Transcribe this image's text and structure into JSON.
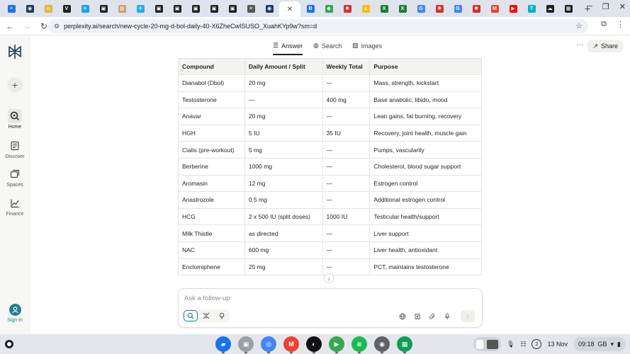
{
  "browser": {
    "tabs": [
      {
        "icon": "tab-favicon",
        "color": "#1a73e8",
        "glyph": "≡"
      },
      {
        "icon": "tab-favicon",
        "color": "#1e3a5f",
        "glyph": "◉"
      },
      {
        "icon": "tab-favicon",
        "color": "#e8b339",
        "glyph": "◎"
      },
      {
        "icon": "tab-favicon",
        "color": "#222222",
        "glyph": "V"
      },
      {
        "icon": "tab-favicon",
        "color": "#1da1f2",
        "glyph": "✈"
      },
      {
        "icon": "tab-favicon",
        "color": "#222222",
        "glyph": "▣"
      },
      {
        "icon": "tab-favicon",
        "color": "#c8a36b",
        "glyph": "▥"
      },
      {
        "icon": "tab-favicon",
        "color": "#2aabee",
        "glyph": "✈"
      },
      {
        "icon": "tab-favicon",
        "color": "#222222",
        "glyph": "▣"
      },
      {
        "icon": "tab-favicon",
        "color": "#222222",
        "glyph": "▣"
      },
      {
        "icon": "tab-favicon",
        "color": "#222222",
        "glyph": "▣"
      },
      {
        "icon": "tab-favicon",
        "color": "#222222",
        "glyph": "▣"
      },
      {
        "icon": "tab-favicon",
        "color": "#222222",
        "glyph": "▣"
      },
      {
        "icon": "tab-favicon",
        "color": "#555555",
        "glyph": "✕"
      },
      {
        "icon": "tab-favicon",
        "color": "#1e3a5f",
        "glyph": "◉"
      }
    ],
    "active_tab_close": "✕",
    "tabs_after": [
      {
        "icon": "tab-favicon",
        "color": "#1a73e8",
        "glyph": "B"
      },
      {
        "icon": "tab-favicon",
        "color": "#34a853",
        "glyph": "◆"
      },
      {
        "icon": "tab-favicon",
        "color": "#d93025",
        "glyph": "✱"
      },
      {
        "icon": "tab-favicon",
        "color": "#fbbc04",
        "glyph": "▲"
      },
      {
        "icon": "tab-favicon",
        "color": "#188038",
        "glyph": "X"
      },
      {
        "icon": "tab-favicon",
        "color": "#188038",
        "glyph": "X"
      },
      {
        "icon": "tab-favicon",
        "color": "#4285f4",
        "glyph": "G"
      },
      {
        "icon": "tab-favicon",
        "color": "#d93025",
        "glyph": "✱"
      },
      {
        "icon": "tab-favicon",
        "color": "#4285f4",
        "glyph": "G"
      },
      {
        "icon": "tab-favicon",
        "color": "#d93025",
        "glyph": "✱"
      },
      {
        "icon": "tab-favicon",
        "color": "#ea4335",
        "glyph": "M"
      },
      {
        "icon": "tab-favicon",
        "color": "#ff0000",
        "glyph": "▶"
      },
      {
        "icon": "tab-favicon",
        "color": "#00b3c7",
        "glyph": "T"
      },
      {
        "icon": "tab-favicon",
        "color": "#222222",
        "glyph": "☁"
      },
      {
        "icon": "tab-favicon",
        "color": "#222222",
        "glyph": "▦"
      }
    ],
    "new_tab": "+",
    "url": "perplexity.ai/search/new-cycle-20-mg-d-bol-daily-40-X6ZheCwISUSO_XuahKYp9w?sm=d"
  },
  "sidebar": {
    "items": [
      {
        "label": "Home"
      },
      {
        "label": "Discover"
      },
      {
        "label": "Spaces"
      },
      {
        "label": "Finance"
      }
    ],
    "sign_in": "Sign In"
  },
  "topnav": {
    "answer": "Answer",
    "search": "Search",
    "images": "Images",
    "more": "···",
    "share": "Share"
  },
  "table": {
    "headers": [
      "Compound",
      "Daily Amount / Split",
      "Weekly Total",
      "Purpose"
    ],
    "rows": [
      [
        "Dianabol (Dbol)",
        "20 mg",
        "—",
        "Mass, strength, kickstart"
      ],
      [
        "Testosterone",
        "—",
        "400 mg",
        "Base anabolic, libido, mood"
      ],
      [
        "Anavar",
        "20 mg",
        "—",
        "Lean gains, fat burning, recovery"
      ],
      [
        "HGH",
        "5 IU",
        "35 IU",
        "Recovery, joint health, muscle gain"
      ],
      [
        "Cialis (pre-workout)",
        "5 mg",
        "—",
        "Pumps, vascularity"
      ],
      [
        "Berberine",
        "1000 mg",
        "—",
        "Cholesterol, blood sugar support"
      ],
      [
        "Aromasin",
        "12 mg",
        "—",
        "Estrogen control"
      ],
      [
        "Anastrozole",
        "0.5 mg",
        "—",
        "Additional estrogen control"
      ],
      [
        "HCG",
        "2 x 500 IU (split doses)",
        "1000 IU",
        "Testicular health/support"
      ],
      [
        "Milk Thistle",
        "as directed",
        "—",
        "Liver support"
      ],
      [
        "NAC",
        "600 mg",
        "—",
        "Liver health, antioxidant"
      ],
      [
        "Enclomiphene",
        "25 mg",
        "—",
        "PCT, maintains testosterone"
      ]
    ]
  },
  "ask": {
    "placeholder": "Ask a follow-up"
  },
  "shelf": {
    "apps": [
      {
        "name": "files",
        "color": "#1a73e8",
        "glyph": "▰"
      },
      {
        "name": "app2",
        "color": "#9aa0a6",
        "glyph": "▣"
      },
      {
        "name": "chrome",
        "color": "#4285f4",
        "glyph": "◎"
      },
      {
        "name": "gmail",
        "color": "#ea4335",
        "glyph": "M"
      },
      {
        "name": "app5",
        "color": "#111111",
        "glyph": "◐"
      },
      {
        "name": "play-store",
        "color": "#34a853",
        "glyph": "▶"
      },
      {
        "name": "spotify",
        "color": "#1db954",
        "glyph": "≋"
      },
      {
        "name": "app8",
        "color": "#5f6368",
        "glyph": "◉"
      },
      {
        "name": "app9",
        "color": "#0f9d58",
        "glyph": "▦"
      }
    ],
    "notification_count": "2",
    "date": "13 Nov",
    "time": "09:18",
    "region": "GB"
  },
  "colors": {
    "accent": "#20808d"
  }
}
